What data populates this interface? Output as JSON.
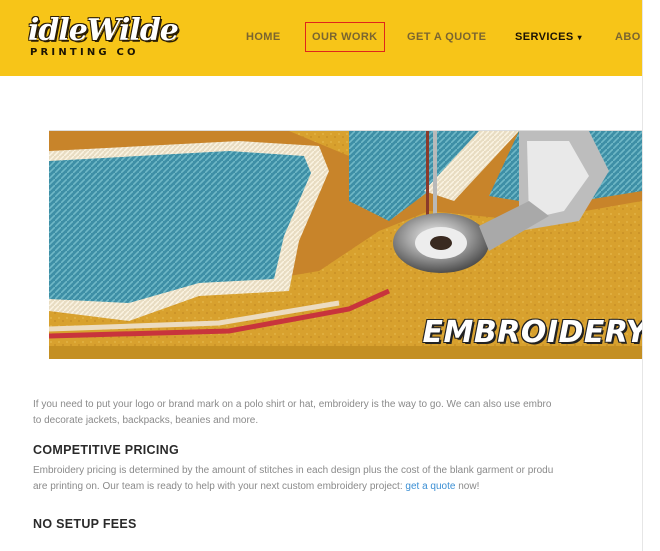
{
  "header": {
    "logo_script": "idleWilde",
    "logo_sub": "PRINTING CO",
    "nav": {
      "home": "HOME",
      "our_work": "OUR WORK",
      "get_a_quote": "GET A QUOTE",
      "services": "SERVICES",
      "about": "ABO"
    },
    "active_item": "OUR WORK",
    "colors": {
      "background": "#f7c518",
      "active_outline": "#e0261b"
    }
  },
  "hero": {
    "label": "EMBROIDERY"
  },
  "content": {
    "intro": {
      "line1": "If you need to put your logo or brand mark on a polo shirt or hat, embroidery is the way to go. We can also use embro",
      "line2": "to decorate jackets, backpacks, beanies and more."
    },
    "section1": {
      "heading": "COMPETITIVE PRICING",
      "line1": "Embroidery pricing is determined by the amount of stitches in each design plus the cost of the blank garment or produ",
      "line2_before": "are printing on. Our team is ready to help with your next custom embroidery project:",
      "line2_link": "get a quote",
      "line2_after": "now!"
    },
    "section2": {
      "heading": "NO SETUP FEES"
    }
  }
}
